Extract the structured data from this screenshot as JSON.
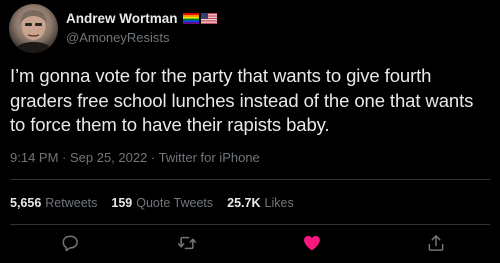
{
  "author": {
    "display_name": "Andrew Wortman",
    "handle": "@AmoneyResists",
    "avatar_icon": "avatar-photo",
    "flags": [
      "rainbow-pride-flag-icon",
      "us-flag-icon"
    ]
  },
  "tweet": {
    "text": "I’m gonna vote for the party that wants to give fourth graders free school lunches instead of the one that wants to force them to have their rapists baby.",
    "meta": "9:14 PM · Sep 25, 2022 · Twitter for iPhone"
  },
  "stats": [
    {
      "count": "5,656",
      "label": "Retweets"
    },
    {
      "count": "159",
      "label": "Quote Tweets"
    },
    {
      "count": "25.7K",
      "label": "Likes"
    }
  ],
  "actions": [
    {
      "icon": "reply-icon"
    },
    {
      "icon": "retweet-icon"
    },
    {
      "icon": "like-heart-icon",
      "active": true,
      "color": "#f91880"
    },
    {
      "icon": "share-icon"
    }
  ],
  "colors": {
    "background": "#000000",
    "primary_text": "#e7e9ea",
    "secondary_text": "#71767b",
    "divider": "#2f3336",
    "like_active": "#f91880"
  }
}
